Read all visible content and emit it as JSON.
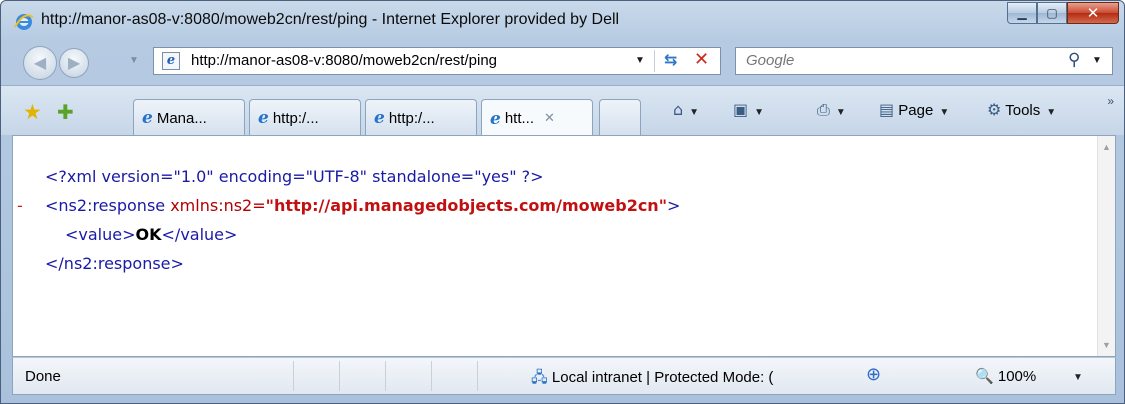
{
  "window": {
    "title": "http://manor-as08-v:8080/moweb2cn/rest/ping - Internet Explorer provided by Dell"
  },
  "address_bar": {
    "url": "http://manor-as08-v:8080/moweb2cn/rest/ping"
  },
  "search": {
    "placeholder": "Google"
  },
  "tabs": [
    {
      "label": "Mana...",
      "active": false
    },
    {
      "label": "http:/...",
      "active": false
    },
    {
      "label": "http:/...",
      "active": false
    },
    {
      "label": "htt...",
      "active": true
    }
  ],
  "command_bar": {
    "page_label": "Page",
    "tools_label": "Tools"
  },
  "content": {
    "xml_decl": "<?xml version=\"1.0\" encoding=\"UTF-8\" standalone=\"yes\" ?>",
    "collapse_marker": "-",
    "response_open_tag": "<ns2:response",
    "xmlns_attr": " xmlns:ns2=",
    "xmlns_value": "\"http://api.managedobjects.com/moweb2cn\"",
    "response_open_close": ">",
    "value_open": "<value>",
    "value_text": "OK",
    "value_close": "</value>",
    "response_close_tag": "</ns2:response>"
  },
  "status_bar": {
    "status": "Done",
    "zone": "Local intranet | Protected Mode: (",
    "zoom": "100%"
  },
  "icons": {
    "ie": "ie-logo-icon",
    "back": "back-arrow-icon",
    "forward": "forward-arrow-icon",
    "refresh": "refresh-icon",
    "stop": "stop-icon",
    "search": "search-icon",
    "favorites": "favorites-star-icon",
    "add_favorites": "add-favorites-icon",
    "home": "home-icon",
    "feeds": "feeds-icon",
    "print": "print-icon",
    "tools": "gear-icon",
    "zone": "local-intranet-icon",
    "protected": "protected-mode-icon",
    "zoom": "zoom-icon"
  }
}
